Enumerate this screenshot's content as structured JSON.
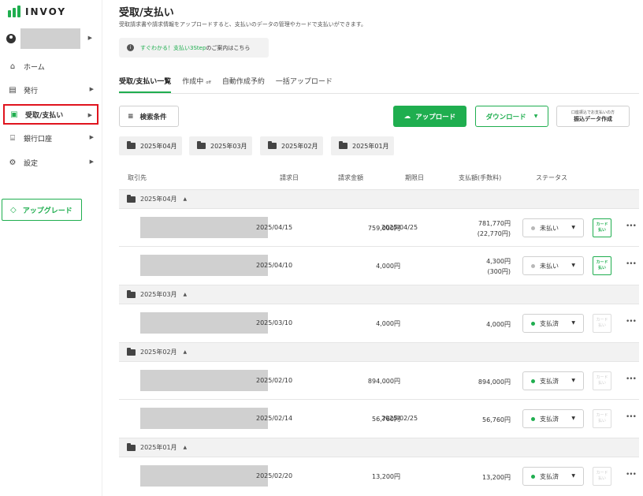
{
  "app": {
    "logo_text": "INVOY",
    "brand_color": "#1fae4f",
    "highlight_color": "#e0141e"
  },
  "sidebar": {
    "account_icon": "user-circle-icon",
    "items": [
      {
        "label": "ホーム",
        "icon": "home-icon"
      },
      {
        "label": "発行",
        "icon": "document-icon"
      },
      {
        "label": "受取/支払い",
        "icon": "wallet-icon",
        "active": true
      },
      {
        "label": "銀行口座",
        "icon": "bank-icon"
      },
      {
        "label": "設定",
        "icon": "gear-icon"
      }
    ],
    "upgrade_label": "アップグレード",
    "upgrade_icon": "diamond-icon"
  },
  "header": {
    "title": "受取/支払い",
    "subtitle": "受取請求書や請求情報をアップロードすると、支払いのデータの管理やカードで支払いができます。",
    "info_link": "すぐわかる！支払い3Step",
    "info_suffix": "のご案内はこちら"
  },
  "tabs": [
    {
      "label": "受取/支払い一覧",
      "active": true
    },
    {
      "label": "作成中",
      "badge": "off"
    },
    {
      "label": "自動作成予約"
    },
    {
      "label": "一括アップロード"
    }
  ],
  "toolbar": {
    "search_label": "検索条件",
    "upload_label": "アップロード",
    "download_label": "ダウンロード",
    "transfer_small": "口座振込でお支払いの方",
    "transfer_label": "振込データ作成"
  },
  "month_chips": [
    "2025年04月",
    "2025年03月",
    "2025年02月",
    "2025年01月"
  ],
  "table": {
    "columns": [
      "取引先",
      "請求日",
      "請求金額",
      "期限日",
      "支払額(手数料)",
      "ステータス"
    ],
    "groups": [
      {
        "label": "2025年04月",
        "rows": [
          {
            "date": "2025/04/15",
            "amount": "759,000円",
            "due": "2025/04/25",
            "paid": "781,770円",
            "fee": "(22,770円)",
            "status": "未払い",
            "card": "カード払い",
            "card_enabled": true
          },
          {
            "date": "2025/04/10",
            "amount": "4,000円",
            "due": "",
            "paid": "4,300円",
            "fee": "(300円)",
            "status": "未払い",
            "card": "カード払い",
            "card_enabled": true
          }
        ]
      },
      {
        "label": "2025年03月",
        "rows": [
          {
            "date": "2025/03/10",
            "amount": "4,000円",
            "due": "",
            "paid": "4,000円",
            "fee": "",
            "status": "支払済",
            "card": "カード払い",
            "card_enabled": false
          }
        ]
      },
      {
        "label": "2025年02月",
        "rows": [
          {
            "date": "2025/02/10",
            "amount": "894,000円",
            "due": "",
            "paid": "894,000円",
            "fee": "",
            "status": "支払済",
            "card": "カード払い",
            "card_enabled": false
          },
          {
            "date": "2025/02/14",
            "amount": "56,760円",
            "due": "2025/02/25",
            "paid": "56,760円",
            "fee": "",
            "status": "支払済",
            "card": "カード払い",
            "card_enabled": false
          }
        ]
      },
      {
        "label": "2025年01月",
        "rows": [
          {
            "date": "2025/02/20",
            "amount": "13,200円",
            "due": "",
            "paid": "13,200円",
            "fee": "",
            "status": "支払済",
            "card": "カード払い",
            "card_enabled": false
          }
        ]
      }
    ]
  },
  "status_colors": {
    "未払い": "#b8b8b8",
    "支払済": "#1fae4f"
  }
}
